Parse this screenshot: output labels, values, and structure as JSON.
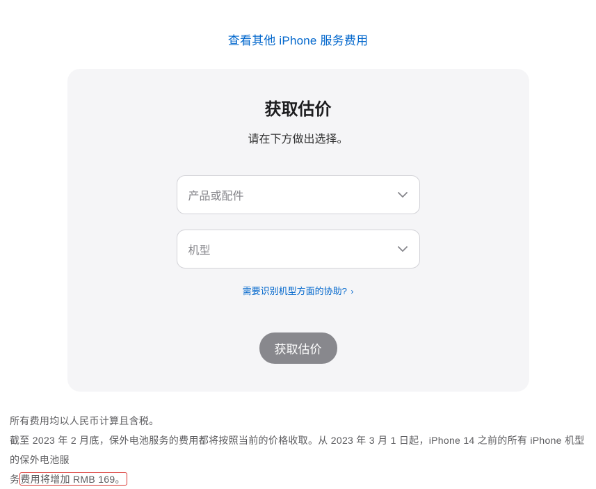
{
  "topLink": "查看其他 iPhone 服务费用",
  "card": {
    "title": "获取估价",
    "subtitle": "请在下方做出选择。",
    "select1": "产品或配件",
    "select2": "机型",
    "helpLink": "需要识别机型方面的协助?",
    "submit": "获取估价"
  },
  "footer": {
    "line1": "所有费用均以人民币计算且含税。",
    "line2_part1": "截至 2023 年 2 月底，保外电池服务的费用都将按照当前的价格收取。从 2023 年 3 月 1 日起，iPhone 14 之前的所有 iPhone 机型的保外电池服",
    "line2_part2": "务",
    "line2_highlight": "费用将增加 RMB 169。"
  }
}
